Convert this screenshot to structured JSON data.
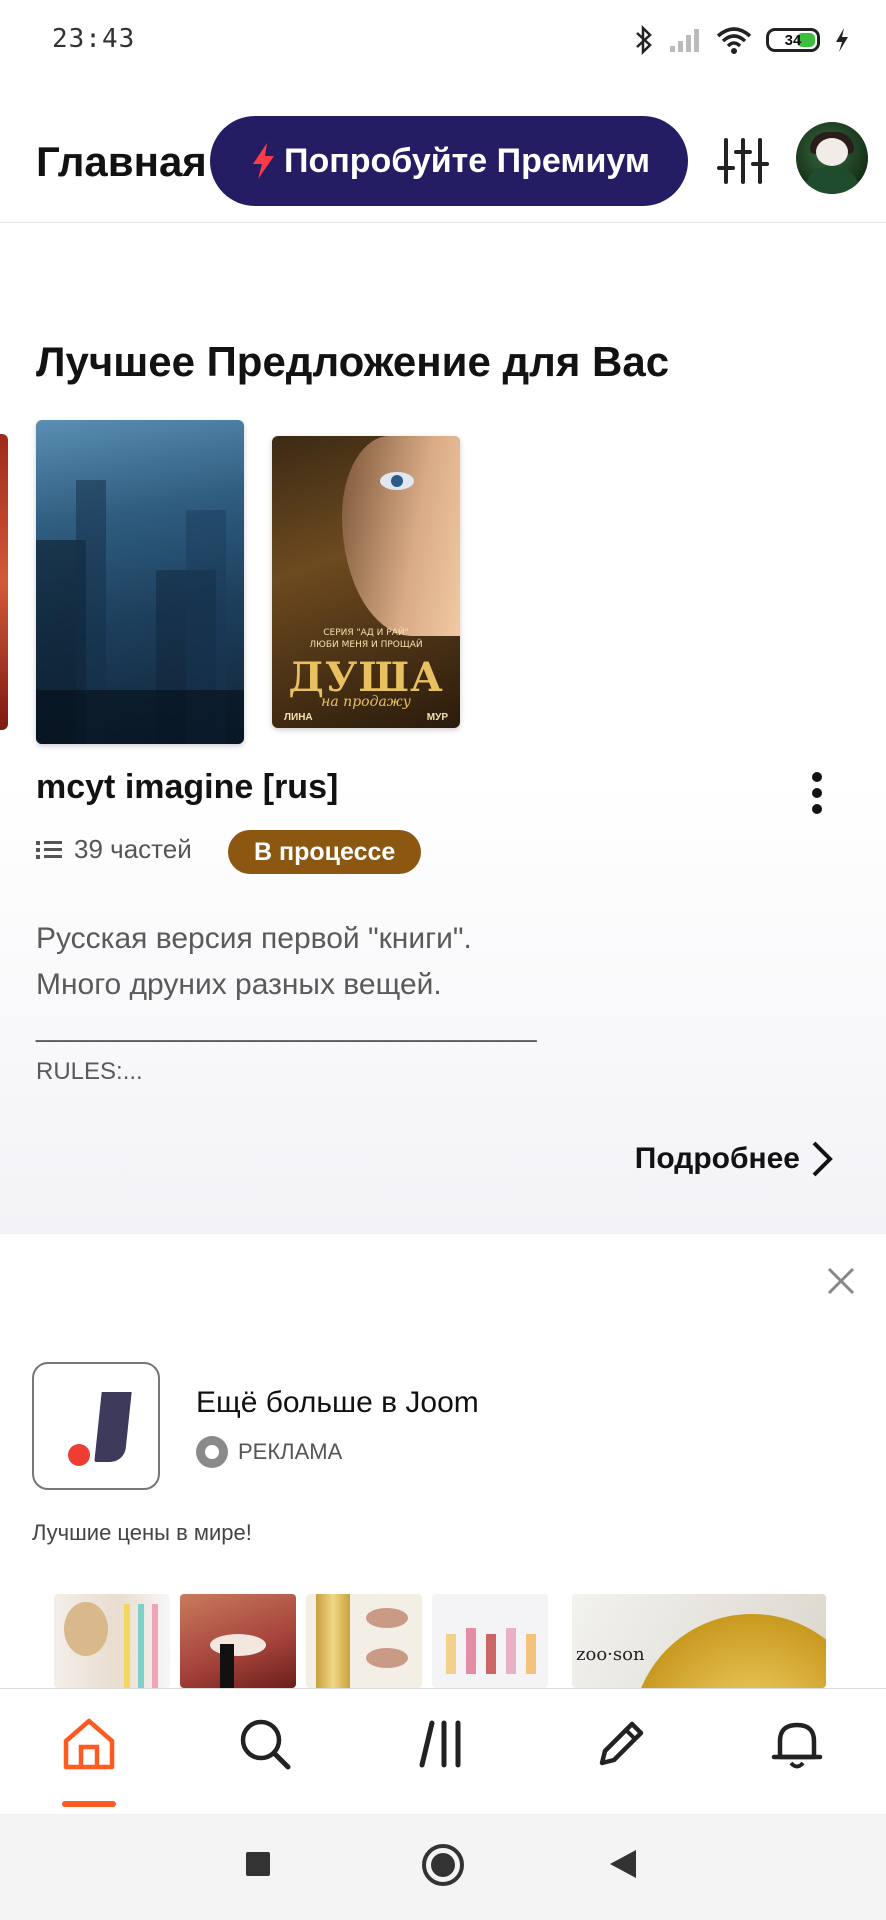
{
  "status_bar": {
    "time": "23:43",
    "battery": "34"
  },
  "header": {
    "title": "Главная",
    "premium_label": "Попробуйте Премиум"
  },
  "section": {
    "title": "Лучшее Предложение для Вас",
    "cover2": {
      "series": "СЕРИЯ \"АД И РАЙ\"",
      "series2": "ЛЮБИ МЕНЯ И ПРОЩАЙ",
      "title": "ДУША",
      "subtitle": "на продажу",
      "author_first": "ЛИНА",
      "author_last": "МУР"
    },
    "story": {
      "title": "mcyt imagine [rus]",
      "parts": "39 частей",
      "status": "В процессе",
      "description_1": "Русская версия первой \"книги\".",
      "description_2": "Много друних разных вещей.",
      "divider": "______________________________",
      "rules": "RULES:...",
      "details": "Подробнее"
    }
  },
  "ad": {
    "title": "Ещё больше в Joom",
    "label": "РЕКЛАМА",
    "tagline": "Лучшие цены в мире!",
    "brand_text": "zoo·son"
  },
  "colors": {
    "premium_bg": "#241d63",
    "accent": "#ff5a1f",
    "status_badge": "#8c5711"
  }
}
